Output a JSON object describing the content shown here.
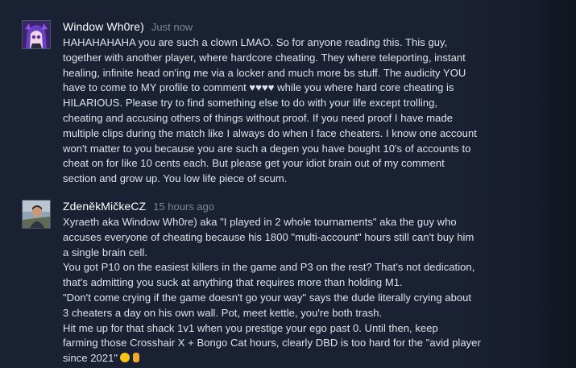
{
  "comments": [
    {
      "author": "Window Wh0re)",
      "timestamp": "Just now",
      "lines": [
        "HAHAHAHAHA you are such a clown LMAO. So for anyone reading this. This guy,",
        "together with another player, where hardcore cheating. They where teleporting, instant",
        "healing, infinite head on'ing me via a locker and much more bs stuff. The audicity YOU",
        "have to come to MY profile to comment ♥♥♥♥ while you where hard core cheating is",
        "HILARIOUS. Please try to find something else to do with your life except trolling,",
        "cheating and accusing others of things without proof. If you need proof I have made",
        "multiple clips during the match like I always do when I face cheaters. I know one account",
        "won't matter to you because you are such a degen you have bought 10's of accounts to",
        "cheat on for like 10 cents each. But please get your idiot brain out of my comment",
        "section and grow up. You low life piece of scum."
      ]
    },
    {
      "author": "ZdeněkMičkeCZ",
      "timestamp": "15 hours ago",
      "lines": [
        "Xyraeth aka Window Wh0re) aka \"I played in 2 whole tournaments\" aka the guy who",
        "accuses everyone of cheating because his 1800 \"multi-account\" hours still can't buy him",
        "a single brain cell.",
        "You got P10 on the easiest killers in the game and P3 on the rest? That's not dedication,",
        "that's admitting you suck at anything that requires more than holding M1.",
        "\"Don't come crying if the game doesn't go your way\" says the dude literally crying about",
        "3 cheaters a day on his own wall. Pot, meet kettle, you're both trash.",
        "Hit me up for that shack 1v1 when you prestige your ego past 0. Until then, keep",
        "farming those Crosshair X + Bongo Cat hours, clearly DBD is too hard for the \"avid player",
        "since 2021\""
      ],
      "trailing_emojis": [
        "laughing-emoji",
        "middle-finger-emoji"
      ]
    }
  ],
  "colors": {
    "background": "#1a2133",
    "author": "#ffffff",
    "timestamp": "#7b8696",
    "body_text": "#dde2ea"
  }
}
